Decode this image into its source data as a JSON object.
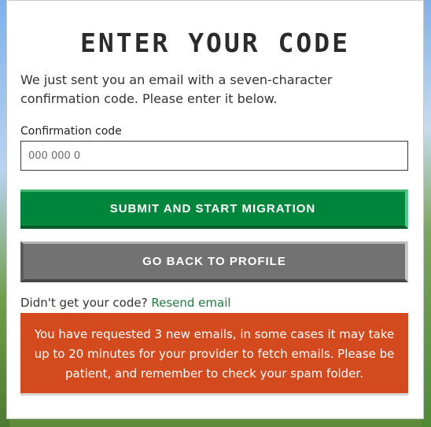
{
  "dialog": {
    "title": "ENTER YOUR CODE",
    "intro": "We just sent you an email with a seven-character confirmation code. Please enter it below."
  },
  "form": {
    "label": "Confirmation code",
    "placeholder": "000 000 0",
    "value": ""
  },
  "buttons": {
    "submit": "SUBMIT AND START MIGRATION",
    "back": "GO BACK TO PROFILE"
  },
  "resend": {
    "prompt": "Didn't get your code?",
    "link": "Resend email"
  },
  "notice": {
    "text": "You have requested 3 new emails, in some cases it may take up to 20 minutes for your provider to fetch emails. Please be patient, and remember to check your spam folder."
  },
  "colors": {
    "submit_green": "#00853d",
    "back_gray": "#727272",
    "notice_orange": "#d34a1f",
    "link_green": "#1f7a3c"
  }
}
